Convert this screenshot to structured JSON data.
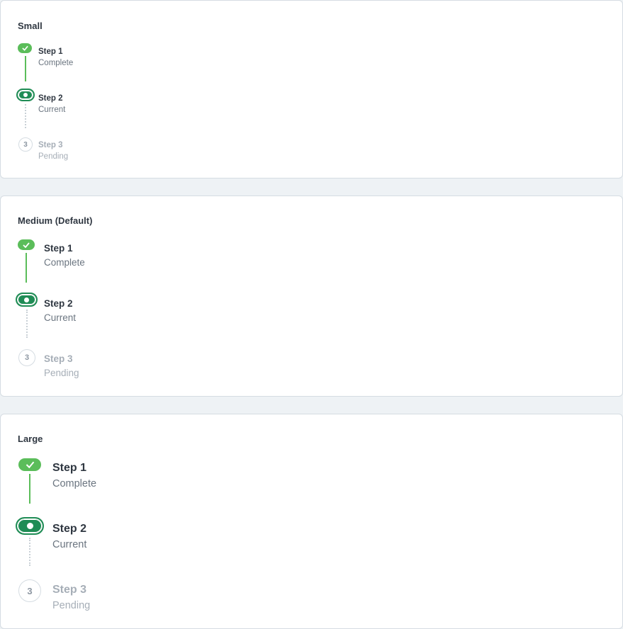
{
  "colors": {
    "complete": "#5bbd5a",
    "current": "#1f8c55",
    "pending_border": "#d5dce2",
    "muted_text": "#a6aeb7"
  },
  "sections": [
    {
      "title": "Small",
      "steps": [
        {
          "title": "Step 1",
          "desc": "Complete",
          "status": "complete",
          "icon": "check-icon"
        },
        {
          "title": "Step 2",
          "desc": "Current",
          "status": "current",
          "icon": "dot-icon"
        },
        {
          "title": "Step 3",
          "desc": "Pending",
          "status": "pending",
          "number": "3"
        }
      ]
    },
    {
      "title": "Medium (Default)",
      "steps": [
        {
          "title": "Step 1",
          "desc": "Complete",
          "status": "complete",
          "icon": "check-icon"
        },
        {
          "title": "Step 2",
          "desc": "Current",
          "status": "current",
          "icon": "dot-icon"
        },
        {
          "title": "Step 3",
          "desc": "Pending",
          "status": "pending",
          "number": "3"
        }
      ]
    },
    {
      "title": "Large",
      "steps": [
        {
          "title": "Step 1",
          "desc": "Complete",
          "status": "complete",
          "icon": "check-icon"
        },
        {
          "title": "Step 2",
          "desc": "Current",
          "status": "current",
          "icon": "dot-icon"
        },
        {
          "title": "Step 3",
          "desc": "Pending",
          "status": "pending",
          "number": "3"
        }
      ]
    }
  ]
}
